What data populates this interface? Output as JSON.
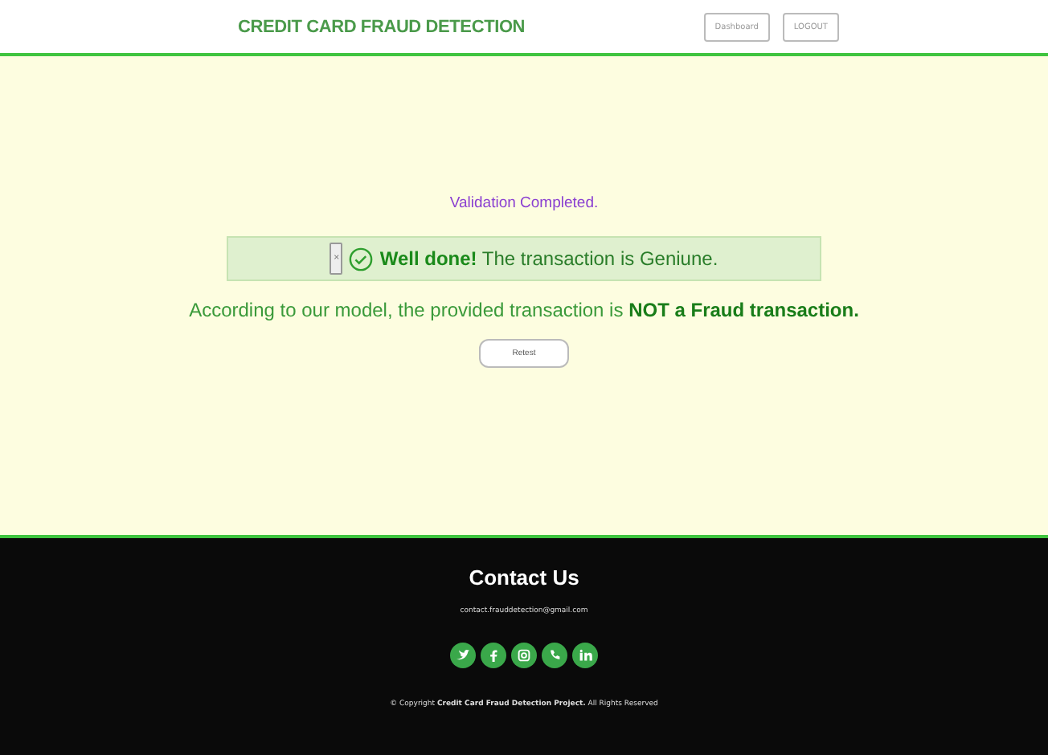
{
  "header": {
    "brand": "CREDIT CARD FRAUD DETECTION",
    "buttons": [
      "Dashboard",
      "LOGOUT"
    ]
  },
  "result": {
    "heading": "Validation Completed.",
    "alert": {
      "close": "×",
      "message": "**Well done!** The transaction is Geniune."
    },
    "verdict": "According to our model, the provided transaction is **NOT a Fraud transaction.**",
    "button": "Retest"
  },
  "footer": {
    "title": "Contact Us",
    "email": "contact.frauddetection@gmail.com",
    "social": [
      {
        "kind": "twitter"
      },
      {
        "kind": "facebook"
      },
      {
        "kind": "instagram"
      },
      {
        "kind": "whatsapp"
      },
      {
        "kind": "linkedin"
      }
    ],
    "copyright": "© Copyright **Credit Card Fraud Detection Project.** All Rights Reserved"
  }
}
